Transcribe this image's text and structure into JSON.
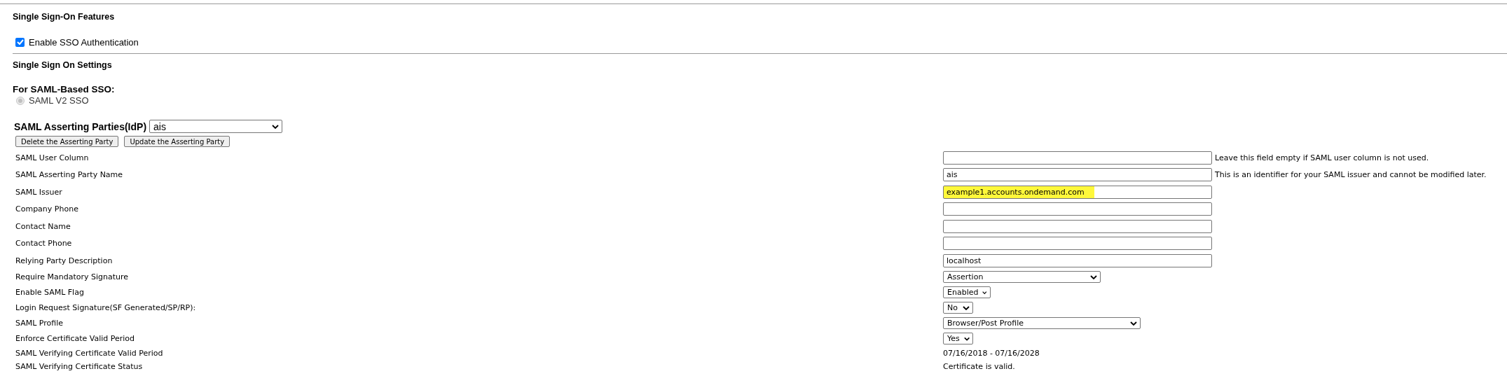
{
  "features": {
    "heading": "Single Sign-On Features",
    "sso_checkbox": {
      "label": "Enable SSO Authentication",
      "checked": true
    }
  },
  "settings": {
    "heading": "Single Sign On Settings",
    "saml_heading": "For SAML-Based SSO:",
    "radio": {
      "label": "SAML V2 SSO",
      "selected": true,
      "disabled": true
    },
    "parties": {
      "label": "SAML Asserting Parties(IdP)",
      "value": "ais"
    },
    "buttons": [
      "Delete the Asserting Party",
      "Update the Asserting Party"
    ]
  },
  "rows": [
    {
      "kind": "input",
      "label": "SAML User Column",
      "value": "",
      "hint": "Leave this field empty if SAML user column is not used."
    },
    {
      "kind": "input",
      "label": "SAML Asserting Party Name",
      "value": "ais",
      "hint": "This is an identifier for your SAML issuer and cannot be modified later."
    },
    {
      "kind": "input",
      "label": "SAML Issuer",
      "value": "example1.accounts.ondemand.com",
      "highlighted": true
    },
    {
      "kind": "input",
      "label": "Company Phone",
      "value": ""
    },
    {
      "kind": "input",
      "label": "Contact Name",
      "value": ""
    },
    {
      "kind": "input",
      "label": "Contact Phone",
      "value": ""
    },
    {
      "kind": "input",
      "label": "Relying Party Description",
      "value": "localhost"
    },
    {
      "kind": "select",
      "label": "Require Mandatory Signature",
      "value": "Assertion"
    },
    {
      "kind": "select",
      "label": "Enable SAML Flag",
      "value": "Enabled"
    },
    {
      "kind": "select",
      "label": "Login Request Signature(SF Generated/SP/RP):",
      "value": "No"
    },
    {
      "kind": "select",
      "label": "SAML Profile",
      "value": "Browser/Post Profile"
    },
    {
      "kind": "select",
      "label": "Enforce Certificate Valid Period",
      "value": "Yes"
    },
    {
      "kind": "static",
      "label": "SAML Verifying Certificate Valid Period",
      "value": "07/16/2018 - 07/16/2028"
    },
    {
      "kind": "static",
      "label": "SAML Verifying Certificate Status",
      "value": "Certificate is valid."
    }
  ]
}
